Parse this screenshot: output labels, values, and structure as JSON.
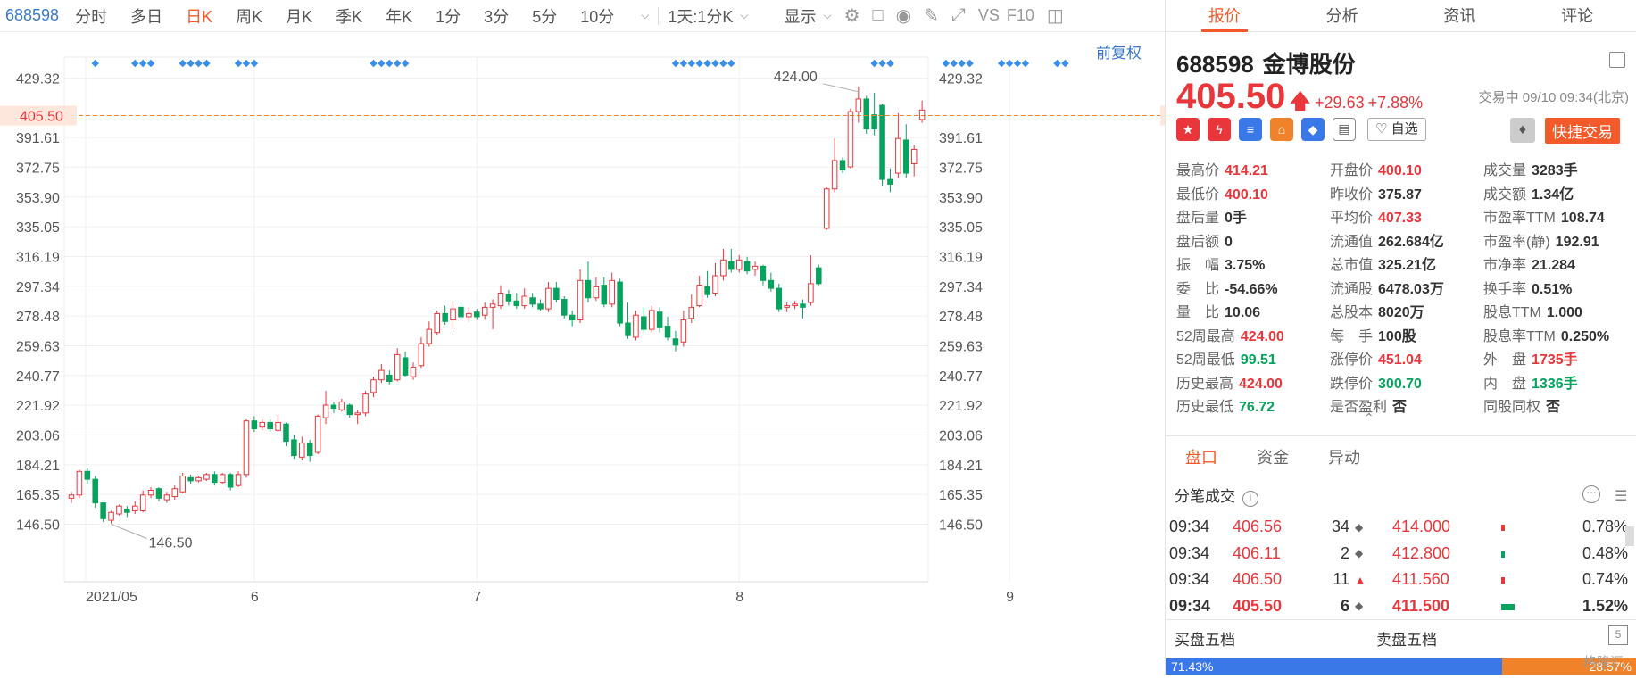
{
  "toolbar": {
    "code": "688598",
    "periods": [
      "分时",
      "多日",
      "日K",
      "周K",
      "月K",
      "季K",
      "年K",
      "1分",
      "3分",
      "5分",
      "10分"
    ],
    "active_period": "日K",
    "interval_select": "1天:1分K",
    "display_label": "显示",
    "vs_label": "VS",
    "f10_label": "F10"
  },
  "chart": {
    "adjust_label": "前复权",
    "price_line": "405.50",
    "high_label": "424.00",
    "low_label": "146.50",
    "x_labels": [
      "2021/05",
      "6",
      "7",
      "8",
      "9"
    ]
  },
  "chart_data": {
    "type": "candlestick",
    "yticks": [
      146.5,
      165.35,
      184.21,
      203.06,
      221.92,
      240.77,
      259.63,
      278.48,
      297.34,
      316.19,
      335.05,
      353.9,
      372.75,
      391.61,
      405.5,
      429.32
    ],
    "ylim": [
      146.5,
      429.32
    ],
    "x_ticks": [
      "2021/05",
      "6",
      "7",
      "8",
      "9"
    ],
    "current_price": 405.5,
    "max": 424.0,
    "min": 146.5,
    "candles": [
      [
        163,
        165,
        160,
        167
      ],
      [
        165,
        180,
        163,
        181
      ],
      [
        180,
        175,
        172,
        182
      ],
      [
        175,
        160,
        157,
        177
      ],
      [
        160,
        150,
        148,
        160
      ],
      [
        149,
        154,
        147,
        155
      ],
      [
        153,
        158,
        152,
        159
      ],
      [
        156,
        154,
        151,
        158
      ],
      [
        155,
        158,
        153,
        161
      ],
      [
        155,
        165,
        154,
        168
      ],
      [
        165,
        168,
        163,
        170
      ],
      [
        169,
        163,
        161,
        170
      ],
      [
        162,
        165,
        160,
        167
      ],
      [
        164,
        169,
        162,
        171
      ],
      [
        167,
        177,
        166,
        179
      ],
      [
        176,
        174,
        172,
        178
      ],
      [
        174,
        176,
        173,
        177
      ],
      [
        175,
        178,
        174,
        179
      ],
      [
        178,
        173,
        171,
        180
      ],
      [
        173,
        178,
        172,
        179
      ],
      [
        178,
        170,
        168,
        179
      ],
      [
        171,
        178,
        170,
        180
      ],
      [
        178,
        212,
        176,
        213
      ],
      [
        212,
        207,
        205,
        215
      ],
      [
        208,
        211,
        206,
        213
      ],
      [
        211,
        207,
        205,
        213
      ],
      [
        206,
        211,
        205,
        216
      ],
      [
        210,
        199,
        196,
        211
      ],
      [
        200,
        190,
        188,
        203
      ],
      [
        189,
        198,
        187,
        202
      ],
      [
        198,
        190,
        186,
        200
      ],
      [
        192,
        215,
        191,
        216
      ],
      [
        214,
        222,
        210,
        231
      ],
      [
        222,
        220,
        217,
        224
      ],
      [
        219,
        224,
        218,
        226
      ],
      [
        222,
        216,
        214,
        223
      ],
      [
        216,
        217,
        210,
        219
      ],
      [
        217,
        229,
        215,
        231
      ],
      [
        230,
        238,
        227,
        240
      ],
      [
        238,
        244,
        236,
        248
      ],
      [
        241,
        237,
        235,
        244
      ],
      [
        238,
        254,
        237,
        258
      ],
      [
        252,
        241,
        240,
        256
      ],
      [
        240,
        246,
        238,
        249
      ],
      [
        247,
        261,
        245,
        265
      ],
      [
        261,
        270,
        259,
        275
      ],
      [
        268,
        280,
        266,
        282
      ],
      [
        280,
        275,
        273,
        285
      ],
      [
        276,
        283,
        270,
        288
      ],
      [
        284,
        278,
        276,
        287
      ],
      [
        278,
        280,
        275,
        284
      ],
      [
        281,
        278,
        276,
        283
      ],
      [
        279,
        284,
        276,
        287
      ],
      [
        284,
        286,
        270,
        289
      ],
      [
        285,
        293,
        283,
        298
      ],
      [
        292,
        288,
        285,
        295
      ],
      [
        288,
        285,
        283,
        293
      ],
      [
        285,
        291,
        283,
        296
      ],
      [
        290,
        286,
        284,
        293
      ],
      [
        286,
        283,
        282,
        289
      ],
      [
        283,
        296,
        281,
        300
      ],
      [
        296,
        289,
        287,
        300
      ],
      [
        289,
        279,
        277,
        291
      ],
      [
        279,
        276,
        272,
        282
      ],
      [
        276,
        301,
        274,
        308
      ],
      [
        301,
        290,
        287,
        313
      ],
      [
        290,
        297,
        288,
        303
      ],
      [
        298,
        286,
        284,
        303
      ],
      [
        286,
        301,
        284,
        306
      ],
      [
        300,
        274,
        272,
        302
      ],
      [
        274,
        266,
        264,
        287
      ],
      [
        265,
        279,
        263,
        282
      ],
      [
        278,
        270,
        268,
        284
      ],
      [
        270,
        282,
        268,
        285
      ],
      [
        281,
        271,
        268,
        284
      ],
      [
        272,
        265,
        263,
        278
      ],
      [
        264,
        260,
        256,
        269
      ],
      [
        262,
        276,
        259,
        282
      ],
      [
        277,
        284,
        274,
        292
      ],
      [
        285,
        298,
        284,
        304
      ],
      [
        297,
        292,
        290,
        307
      ],
      [
        293,
        304,
        291,
        312
      ],
      [
        304,
        314,
        301,
        321
      ],
      [
        313,
        308,
        306,
        321
      ],
      [
        308,
        314,
        306,
        317
      ],
      [
        313,
        307,
        305,
        316
      ],
      [
        308,
        310,
        304,
        313
      ],
      [
        310,
        301,
        298,
        311
      ],
      [
        301,
        296,
        294,
        306
      ],
      [
        296,
        283,
        281,
        299
      ],
      [
        284,
        285,
        281,
        287
      ],
      [
        285,
        286,
        283,
        288
      ],
      [
        286,
        284,
        277,
        289
      ],
      [
        287,
        299,
        285,
        317
      ],
      [
        309,
        299,
        298,
        311
      ],
      [
        334,
        359,
        333,
        360
      ],
      [
        359,
        377,
        357,
        391
      ],
      [
        377,
        371,
        369,
        379
      ],
      [
        373,
        408,
        372,
        410
      ],
      [
        408,
        416,
        401,
        424
      ],
      [
        416,
        397,
        394,
        418
      ],
      [
        406,
        397,
        393,
        420
      ],
      [
        412,
        365,
        361,
        413
      ],
      [
        365,
        362,
        357,
        372
      ],
      [
        369,
        391,
        366,
        407
      ],
      [
        390,
        369,
        366,
        400
      ],
      [
        375,
        384,
        367,
        387
      ],
      [
        403,
        409,
        401,
        415
      ]
    ],
    "signal_dots": [
      3,
      8,
      9,
      10,
      14,
      15,
      16,
      17,
      21,
      22,
      23,
      38,
      39,
      40,
      41,
      42,
      76,
      77,
      78,
      79,
      80,
      81,
      82,
      83,
      101,
      102,
      103,
      110,
      111,
      112,
      113,
      117,
      118,
      119,
      120,
      124,
      125
    ]
  },
  "header": {
    "tabs": [
      "报价",
      "分析",
      "资讯",
      "评论"
    ],
    "active_tab": "报价",
    "code": "688598",
    "name": "金博股份",
    "price": "405.50",
    "change": "+29.63",
    "change_pct": "+7.88%",
    "status": "交易中 09/10 09:34(北京)",
    "zixuan": "自选",
    "quick_trade": "快捷交易"
  },
  "stats": [
    [
      {
        "l": "最高价",
        "v": "414.21",
        "c": "red"
      },
      {
        "l": "开盘价",
        "v": "400.10",
        "c": "red"
      },
      {
        "l": "成交量",
        "v": "3283手",
        "c": ""
      }
    ],
    [
      {
        "l": "最低价",
        "v": "400.10",
        "c": "red"
      },
      {
        "l": "昨收价",
        "v": "375.87",
        "c": ""
      },
      {
        "l": "成交额",
        "v": "1.34亿",
        "c": ""
      }
    ],
    [
      {
        "l": "盘后量",
        "v": "0手",
        "c": ""
      },
      {
        "l": "平均价",
        "v": "407.33",
        "c": "red"
      },
      {
        "l": "市盈率TTM",
        "v": "108.74",
        "c": ""
      }
    ],
    [
      {
        "l": "盘后额",
        "v": "0",
        "c": ""
      },
      {
        "l": "流通值",
        "v": "262.684亿",
        "c": ""
      },
      {
        "l": "市盈率(静)",
        "v": "192.91",
        "c": ""
      }
    ],
    [
      {
        "l": "振　幅",
        "v": "3.75%",
        "c": ""
      },
      {
        "l": "总市值",
        "v": "325.21亿",
        "c": ""
      },
      {
        "l": "市净率",
        "v": "21.284",
        "c": ""
      }
    ],
    [
      {
        "l": "委　比",
        "v": "-54.66%",
        "c": ""
      },
      {
        "l": "流通股",
        "v": "6478.03万",
        "c": ""
      },
      {
        "l": "换手率",
        "v": "0.51%",
        "c": ""
      }
    ],
    [
      {
        "l": "量　比",
        "v": "10.06",
        "c": ""
      },
      {
        "l": "总股本",
        "v": "8020万",
        "c": ""
      },
      {
        "l": "股息TTM",
        "v": "1.000",
        "c": ""
      }
    ],
    [
      {
        "l": "52周最高",
        "v": "424.00",
        "c": "red"
      },
      {
        "l": "每　手",
        "v": "100股",
        "c": ""
      },
      {
        "l": "股息率TTM",
        "v": "0.250%",
        "c": ""
      }
    ],
    [
      {
        "l": "52周最低",
        "v": "99.51",
        "c": "green"
      },
      {
        "l": "涨停价",
        "v": "451.04",
        "c": "red"
      },
      {
        "l": "外　盘",
        "v": "1735手",
        "c": "red"
      }
    ],
    [
      {
        "l": "历史最高",
        "v": "424.00",
        "c": "red"
      },
      {
        "l": "跌停价",
        "v": "300.70",
        "c": "green"
      },
      {
        "l": "内　盘",
        "v": "1336手",
        "c": "green"
      }
    ],
    [
      {
        "l": "历史最低",
        "v": "76.72",
        "c": "green"
      },
      {
        "l": "是否盈利",
        "v": "否",
        "c": ""
      },
      {
        "l": "同股同权",
        "v": "否",
        "c": ""
      }
    ]
  ],
  "subtabs": [
    "盘口",
    "资金",
    "异动"
  ],
  "ticks_title": "分笔成交",
  "ticks": [
    {
      "time": "09:34",
      "price": "406.56",
      "vol": "34",
      "dir": "◆",
      "level": "414.000",
      "pct": "0.78%",
      "bar_color": "#e8363b",
      "share": 0.2
    },
    {
      "time": "09:34",
      "price": "406.11",
      "vol": "2",
      "dir": "◆",
      "level": "412.800",
      "pct": "0.48%",
      "bar_color": "#07a25d",
      "share": 0.1
    },
    {
      "time": "09:34",
      "price": "406.50",
      "vol": "11",
      "dir": "▲",
      "level": "411.560",
      "pct": "0.74%",
      "bar_color": "#e8363b",
      "share": 0.2
    },
    {
      "time": "09:34",
      "price": "405.50",
      "vol": "6",
      "dir": "◆",
      "level": "411.500",
      "pct": "1.52%",
      "bar_color": "#07a25d",
      "share": 0.75
    }
  ],
  "book": {
    "buy_label": "买盘五档",
    "sell_label": "卖盘五档",
    "buy_pct": "71.43%",
    "sell_pct": "28.57%",
    "buy_share": 0.7143
  },
  "watermark": "格隆汇"
}
